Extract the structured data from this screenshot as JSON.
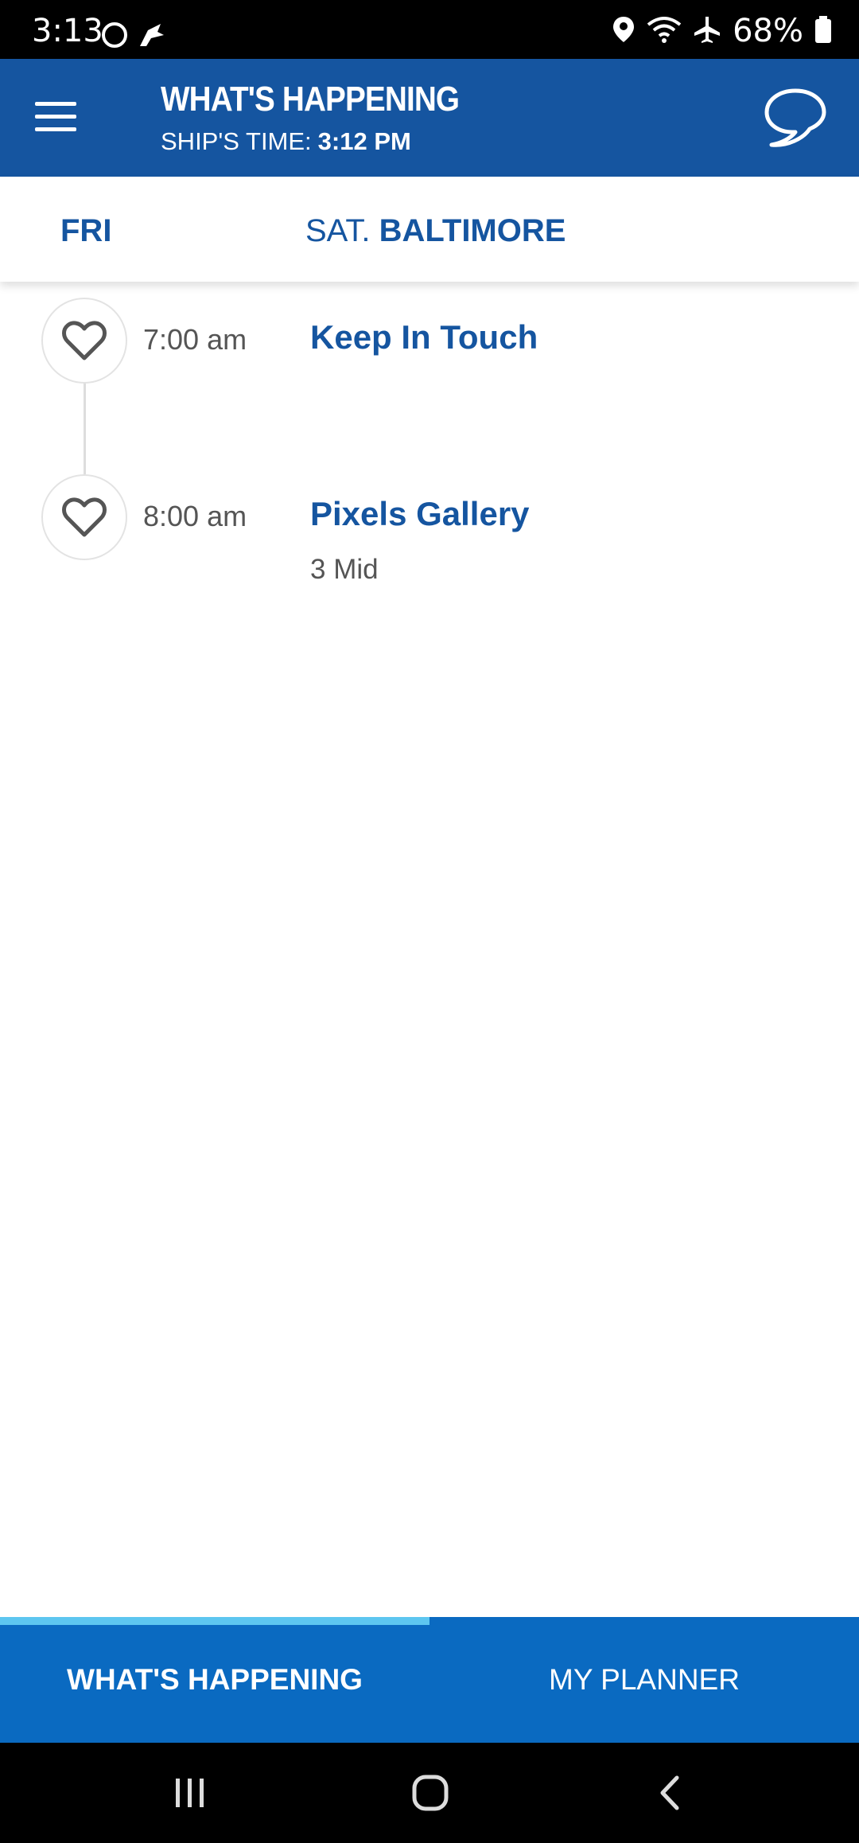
{
  "status_bar": {
    "time": "3:13",
    "battery": "68%"
  },
  "header": {
    "title": "WHAT'S HAPPENING",
    "ship_time_label": "SHIP'S TIME:",
    "ship_time_value": "3:12 PM"
  },
  "day_tabs": {
    "fri": "FRI",
    "sat_prefix": "SAT.",
    "sat_port": "BALTIMORE"
  },
  "events": [
    {
      "time": "7:00 am",
      "title": "Keep In Touch",
      "location": ""
    },
    {
      "time": "8:00 am",
      "title": "Pixels Gallery",
      "location": "3 Mid"
    }
  ],
  "bottom_tabs": {
    "whats_happening": "WHAT'S HAPPENING",
    "my_planner": "MY PLANNER"
  },
  "colors": {
    "brand_blue": "#1555a0",
    "tab_bar_blue": "#0a6ac1",
    "indicator": "#5dc6f0"
  },
  "icons": [
    "location-icon",
    "wifi-icon",
    "airplane-mode-icon",
    "battery-icon",
    "menu-icon",
    "chat-icon",
    "heart-icon",
    "recents-icon",
    "home-icon",
    "back-icon"
  ]
}
